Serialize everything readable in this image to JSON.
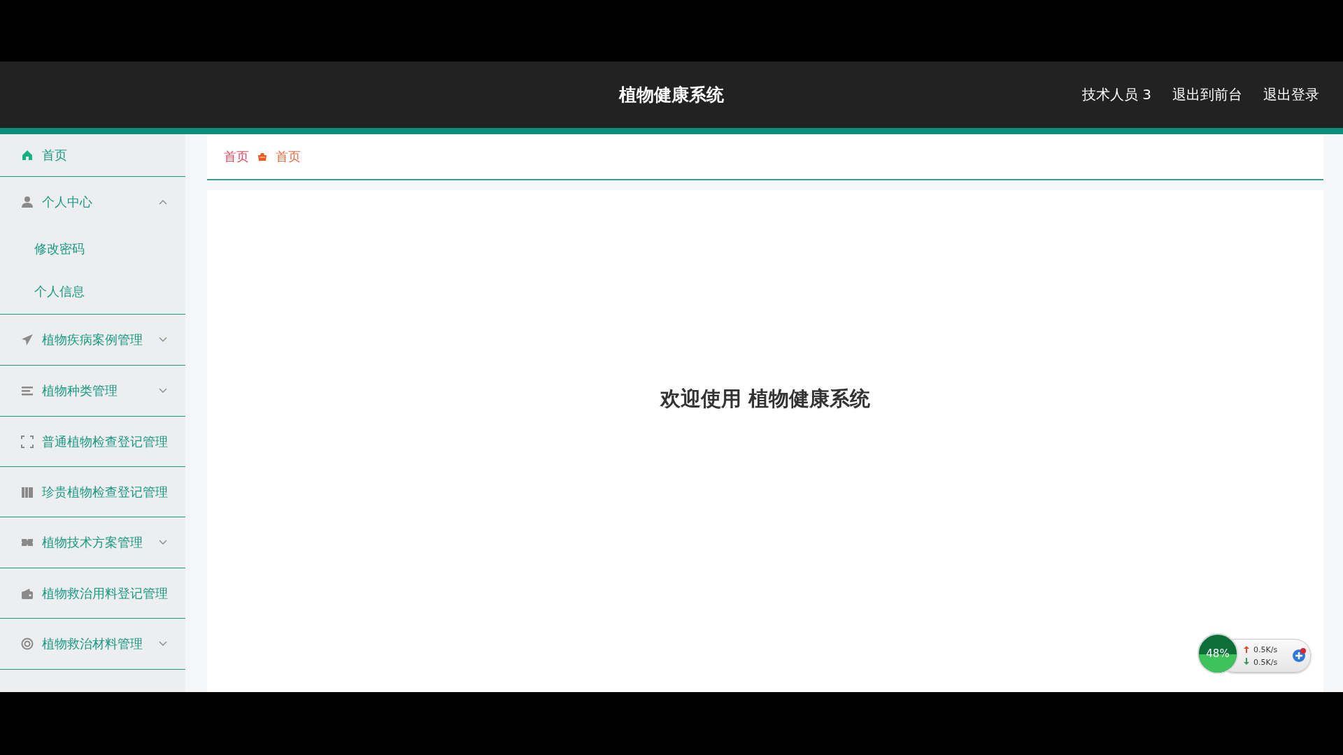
{
  "header": {
    "title": "植物健康系统",
    "user": "技术人员 3",
    "links": [
      "退出到前台",
      "退出登录"
    ]
  },
  "sidebar": {
    "items": [
      {
        "kind": "link",
        "label": "首页",
        "selected": true
      },
      {
        "kind": "group",
        "label": "个人中心",
        "selected": false,
        "expanded": true,
        "children": [
          {
            "label": "修改密码"
          },
          {
            "label": "个人信息"
          }
        ]
      },
      {
        "kind": "group",
        "label": "植物疾病案例管理",
        "selected": false,
        "expanded": false
      },
      {
        "kind": "group",
        "label": "植物种类管理",
        "selected": false,
        "expanded": false
      },
      {
        "kind": "link",
        "label": "普通植物检查登记管理",
        "selected": false
      },
      {
        "kind": "link",
        "label": "珍贵植物检查登记管理",
        "selected": false
      },
      {
        "kind": "group",
        "label": "植物技术方案管理",
        "selected": false,
        "expanded": false
      },
      {
        "kind": "link",
        "label": "植物救治用料登记管理",
        "selected": false
      },
      {
        "kind": "group",
        "label": "植物救治材料管理",
        "selected": false,
        "expanded": false
      }
    ]
  },
  "breadcrumb": [
    "首页",
    "首页"
  ],
  "welcome": "欢迎使用 植物健康系统",
  "net_widget": {
    "memory": "48%",
    "upload": "0.5K/s",
    "download": "0.5K/s"
  }
}
